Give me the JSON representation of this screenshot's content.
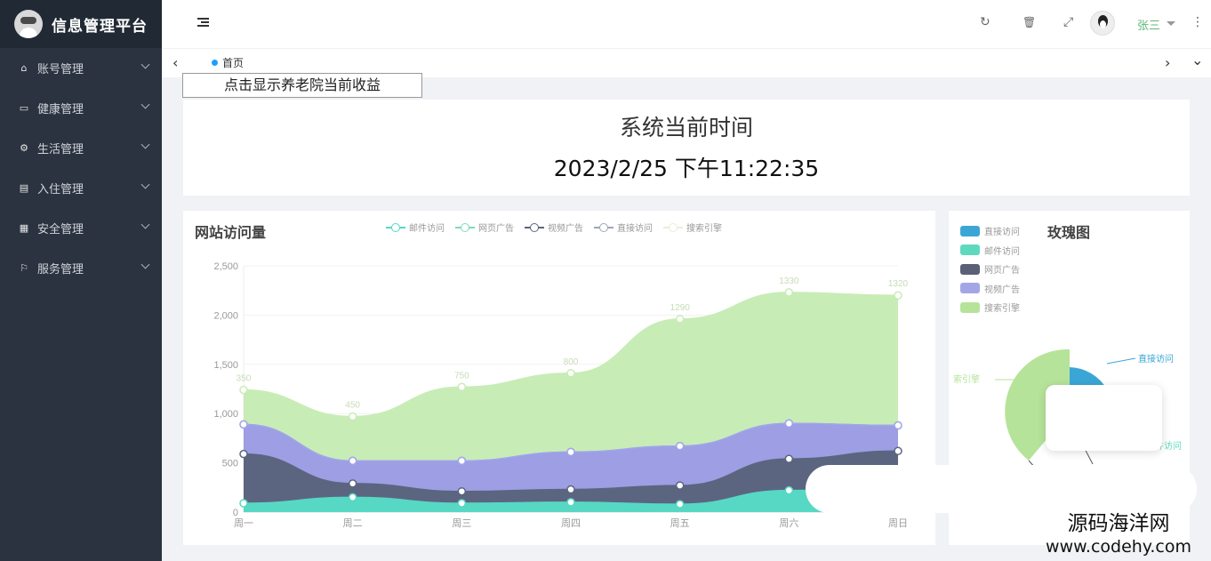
{
  "app": {
    "title": "信息管理平台"
  },
  "sidebar": {
    "items": [
      {
        "label": "账号管理",
        "icon": "home-icon",
        "glyph": "⌂"
      },
      {
        "label": "健康管理",
        "icon": "window-icon",
        "glyph": "▭"
      },
      {
        "label": "生活管理",
        "icon": "gears-icon",
        "glyph": "⚙"
      },
      {
        "label": "入住管理",
        "icon": "file-icon",
        "glyph": "▤"
      },
      {
        "label": "安全管理",
        "icon": "calendar-icon",
        "glyph": "▦"
      },
      {
        "label": "服务管理",
        "icon": "flag-icon",
        "glyph": "⚐"
      }
    ]
  },
  "header": {
    "refresh_icon": "↻",
    "delete_icon": "🗑",
    "fullscreen_icon": "⤢",
    "more_icon": "⋮",
    "user_name": "张三"
  },
  "tabs": {
    "prev": "‹",
    "next": "›",
    "dropdown": "⌄",
    "home_label": "首页"
  },
  "main": {
    "revenue_button": "点击显示养老院当前收益",
    "time_title": "系统当前时间",
    "time_value": "2023/2/25 下午11:22:35"
  },
  "chart_data": [
    {
      "type": "area",
      "title": "网站访问量",
      "stacked": true,
      "categories": [
        "周一",
        "周二",
        "周三",
        "周四",
        "周五",
        "周六",
        "周日"
      ],
      "ylim": [
        0,
        2500
      ],
      "yticks": [
        0,
        500,
        1000,
        1500,
        2000,
        2500
      ],
      "legend_position": "top",
      "series": [
        {
          "name": "邮件访问",
          "color": "#56d8c4",
          "values": [
            90,
            150,
            90,
            100,
            80,
            220,
            230
          ]
        },
        {
          "name": "网页广告",
          "color": "#5c6580",
          "values": [
            500,
            140,
            120,
            130,
            190,
            320,
            390
          ]
        },
        {
          "name": "视频广告",
          "color": "#9d9ee3",
          "values": [
            300,
            230,
            310,
            380,
            400,
            360,
            260
          ]
        },
        {
          "name": "直接访问",
          "color": "#a0a5ee",
          "values": [
            0,
            0,
            0,
            0,
            0,
            0,
            0
          ]
        },
        {
          "name": "搜索引擎",
          "color": "#c8ecb6",
          "values": [
            350,
            450,
            750,
            800,
            1290,
            1330,
            1320
          ]
        }
      ],
      "data_labels": [
        350,
        450,
        750,
        800,
        1290,
        1330,
        1320
      ]
    },
    {
      "type": "pie",
      "title": "玫瑰图",
      "rose": true,
      "legend_position": "left",
      "slices": [
        {
          "name": "直接访问",
          "color": "#3ba6d6"
        },
        {
          "name": "邮件访问",
          "color": "#5ed9be"
        },
        {
          "name": "网页广告",
          "color": "#5a6177"
        },
        {
          "name": "视频广告",
          "color": "#a3a6e6"
        },
        {
          "name": "搜索引擎",
          "color": "#b6e39a"
        }
      ],
      "visible_labels": [
        "直接访问",
        "索引擎",
        "件访问"
      ]
    }
  ],
  "watermark": {
    "line1": "源码海洋网",
    "line2": "www.codehy.com"
  }
}
